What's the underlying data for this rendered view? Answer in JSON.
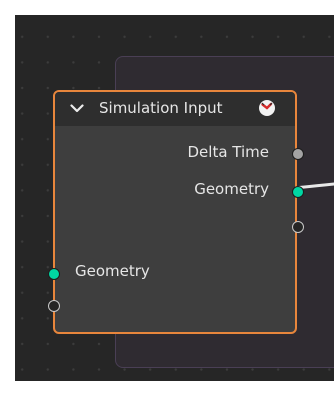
{
  "node": {
    "title": "Simulation Input",
    "outputs": [
      "Delta Time",
      "Geometry"
    ],
    "inputs": [
      "Geometry"
    ]
  },
  "colors": {
    "canvas": "#262626",
    "frame_border": "#e8863c",
    "geometry_socket": "#00d6a3",
    "float_socket": "#a3a3a3"
  },
  "icons": [
    "chevron-down-icon",
    "clock-icon"
  ]
}
